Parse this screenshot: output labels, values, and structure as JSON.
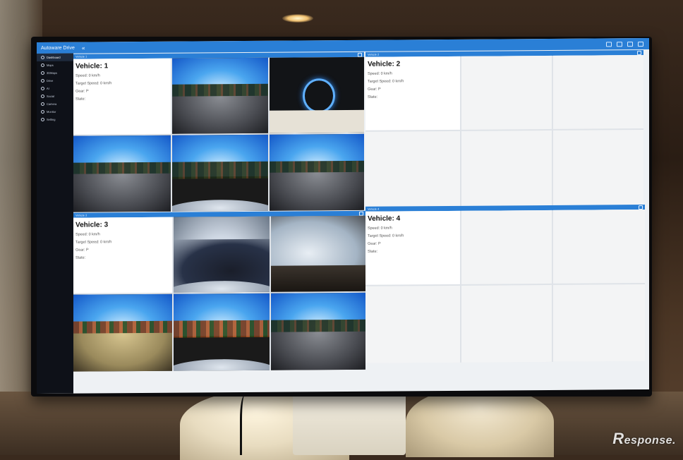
{
  "app": {
    "title": "Autoware Drive",
    "collapse_glyph": "«"
  },
  "sidebar": {
    "items": [
      {
        "label": "Dashboard",
        "icon": "dashboard-icon",
        "active": true
      },
      {
        "label": "Maps",
        "icon": "map-icon"
      },
      {
        "label": "3DMaps",
        "icon": "cube-icon"
      },
      {
        "label": "Drive",
        "icon": "steering-icon"
      },
      {
        "label": "AI",
        "icon": "brain-icon"
      },
      {
        "label": "Social",
        "icon": "people-icon"
      },
      {
        "label": "Camera",
        "icon": "camera-icon"
      },
      {
        "label": "Monitor",
        "icon": "monitor-icon"
      },
      {
        "label": "Setting",
        "icon": "gear-icon"
      }
    ]
  },
  "vehicles": [
    {
      "header": "Vehicle 1",
      "title": "Vehicle: 1",
      "speed": "Speed: 0 km/h",
      "target_speed": "Target Speed: 0 km/h",
      "gear": "Gear: P",
      "state": "State:"
    },
    {
      "header": "Vehicle 2",
      "title": "Vehicle: 2",
      "speed": "Speed: 0 km/h",
      "target_speed": "Target Speed: 0 km/h",
      "gear": "Gear: P",
      "state": "State:"
    },
    {
      "header": "Vehicle 3",
      "title": "Vehicle: 3",
      "speed": "Speed: 0 km/h",
      "target_speed": "Target Speed: 0 km/h",
      "gear": "Gear: P",
      "state": "State:"
    },
    {
      "header": "Vehicle 4",
      "title": "Vehicle: 4",
      "speed": "Speed: 0 km/h",
      "target_speed": "Target Speed: 0 km/h",
      "gear": "Gear: P",
      "state": "State:"
    }
  ],
  "watermark": {
    "text": "esponse.",
    "mark": "R"
  },
  "colors": {
    "accent": "#2a7fd6",
    "sidebar": "#0e1118"
  }
}
